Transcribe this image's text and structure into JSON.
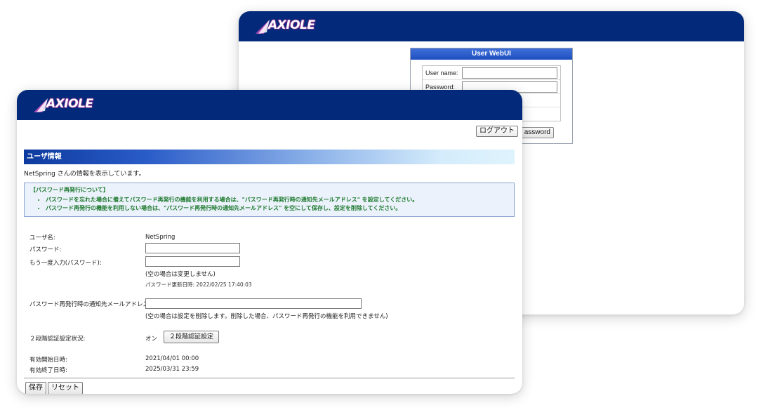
{
  "brand": {
    "logo_text": "AXIOLE"
  },
  "login_window": {
    "panel_title": "User WebUI",
    "username_label": "User name:",
    "password_label": "Password:",
    "password_button_partial": "assword"
  },
  "user_window": {
    "logout_label": "ログアウト",
    "section_title": "ユーザ情報",
    "info_line": "NetSpring さんの情報を表示しています。",
    "notice": {
      "title": "【パスワード再発行について】",
      "items": [
        "パスワードを忘れた場合に備えてパスワード再発行の機能を利用する場合は、\"パスワード再発行時の通知先メールアドレス\" を設定してください。",
        "パスワード再発行の機能を利用しない場合は、\"パスワード再発行時の通知先メールアドレス\" を空にして保存し、設定を削除してください。"
      ]
    },
    "form": {
      "username_label": "ユーザ名:",
      "username_value": "NetSpring",
      "password_label": "パスワード:",
      "password_confirm_label": "もう一度入力(パスワード):",
      "password_hint": "(空の場合は変更しません)",
      "password_updated": "パスワード更新日時: 2022/02/25 17:40:03",
      "reset_email_label": "パスワード再発行時の通知先メールアドレス:",
      "reset_email_hint": "(空の場合は設定を削除します。削除した場合、パスワード再発行の機能を利用できません)",
      "twofa_label": "２段階認証設定状況:",
      "twofa_status": "オン",
      "twofa_button": "２段階認証設定",
      "valid_from_label": "有効開始日時:",
      "valid_from_value": "2021/04/01 00:00",
      "valid_to_label": "有効終了日時:",
      "valid_to_value": "2025/03/31 23:59"
    },
    "save_label": "保存",
    "reset_label": "リセット"
  },
  "colors": {
    "header_bar": "#032a7a",
    "notice_text": "#1e7a2e",
    "notice_bg": "#ecf2fc"
  }
}
